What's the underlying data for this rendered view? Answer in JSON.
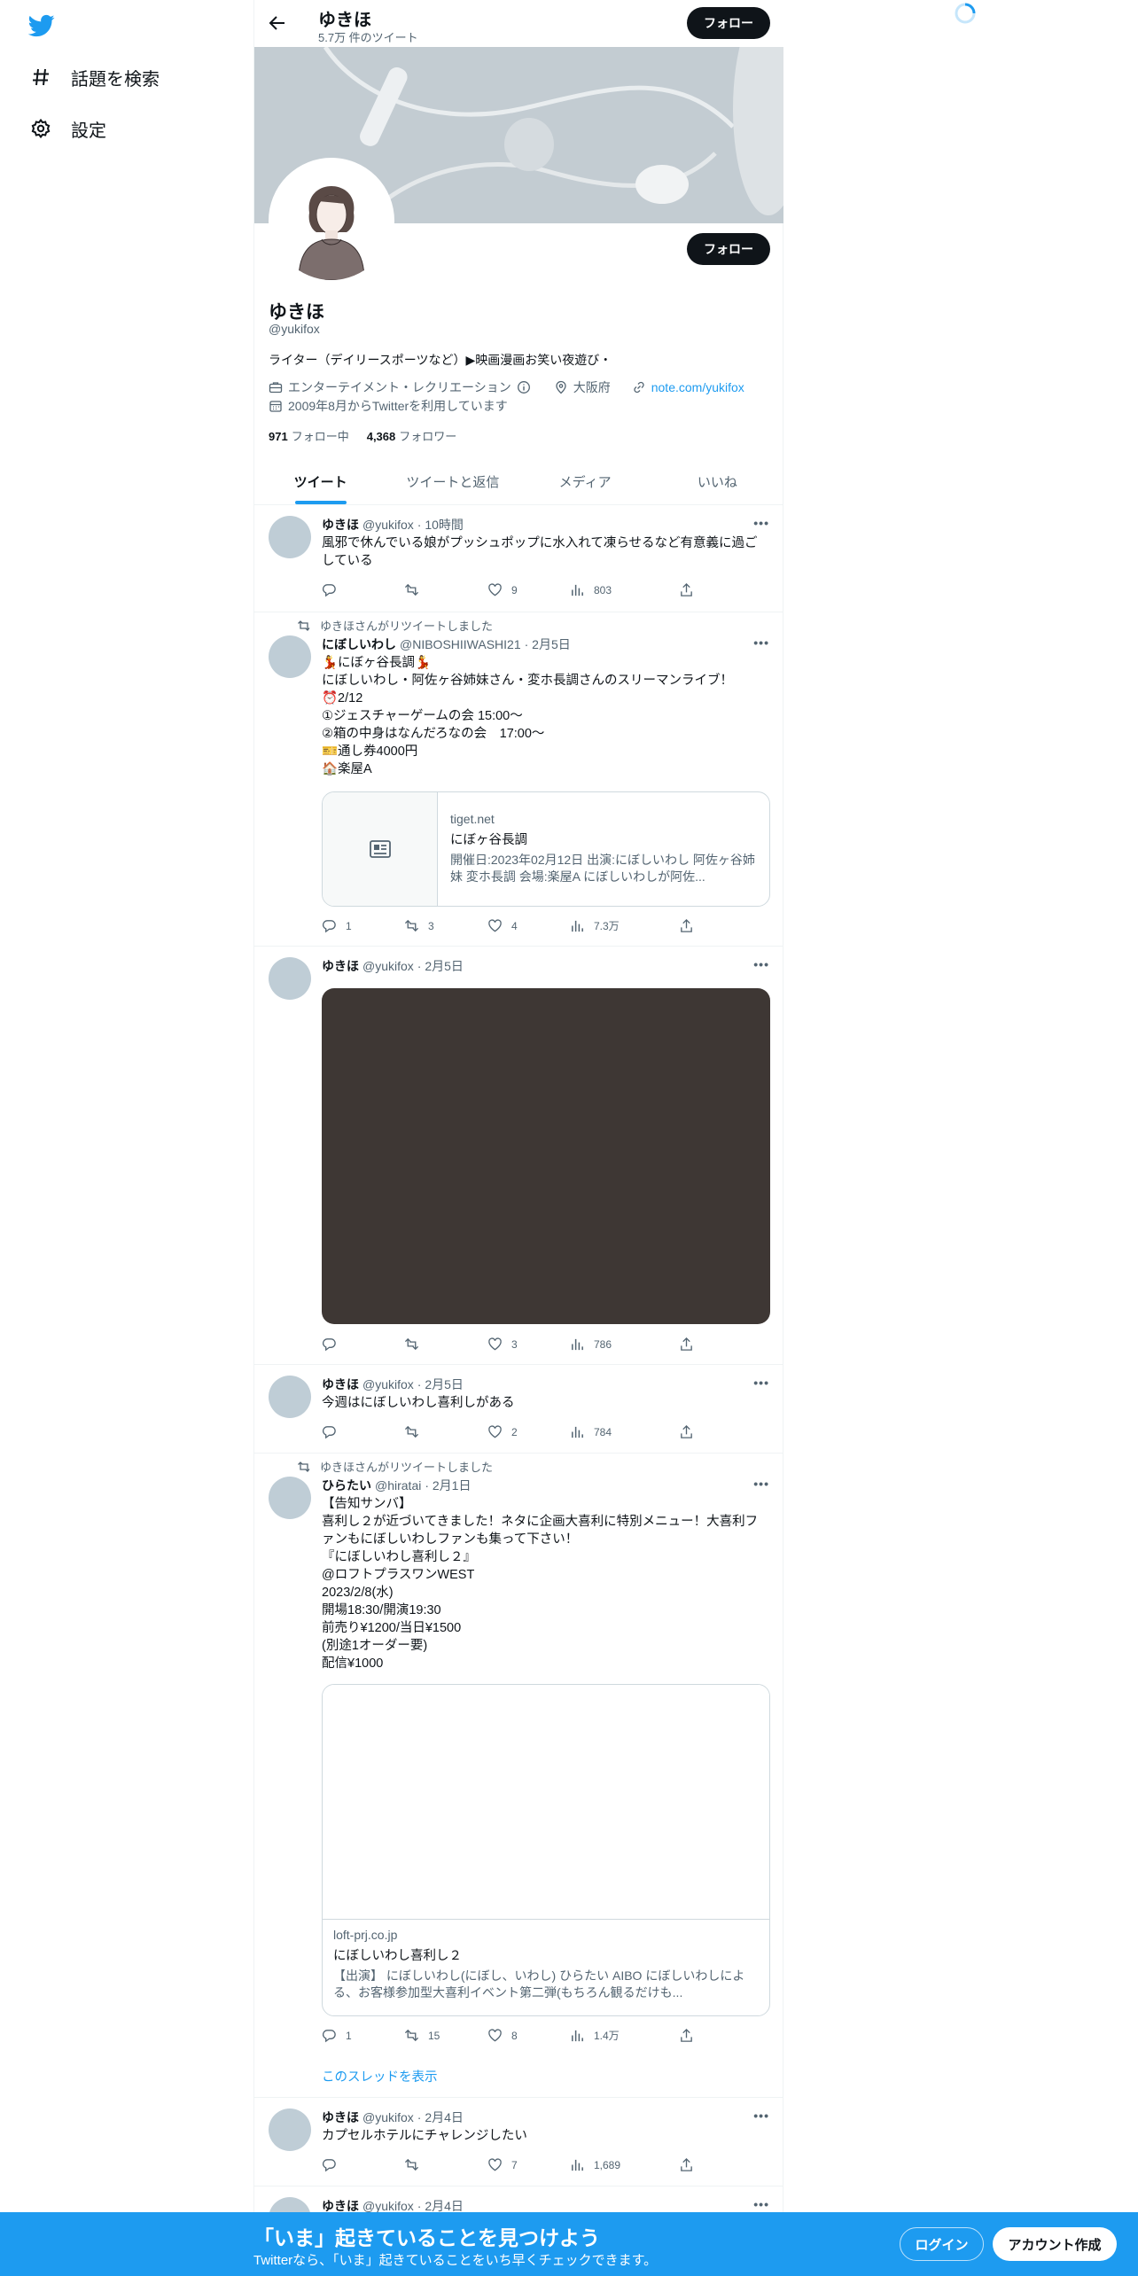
{
  "nav": {
    "explore": "話題を検索",
    "settings": "設定"
  },
  "header": {
    "name": "ゆきほ",
    "tweet_count": "5.7万 件のツイート",
    "follow": "フォロー"
  },
  "profile": {
    "name": "ゆきほ",
    "handle": "@yukifox",
    "bio": "ライター（デイリースポーツなど）▶映画漫画お笑い夜遊び・",
    "category": "エンターテイメント・レクリエーション",
    "location": "大阪府",
    "website": "note.com/yukifox",
    "joined": "2009年8月からTwitterを利用しています",
    "following_count": "971",
    "following_label": "フォロー中",
    "followers_count": "4,368",
    "followers_label": "フォロワー",
    "follow": "フォロー"
  },
  "tabs": [
    "ツイート",
    "ツイートと返信",
    "メディア",
    "いいね"
  ],
  "tweets": [
    {
      "name": "ゆきほ",
      "handle": "@yukifox",
      "time": "· 10時間",
      "text": "風邪で休んでいる娘がプッシュポップに水入れて凍らせるなど有意義に過ごしている",
      "replies": "",
      "retweets": "",
      "likes": "9",
      "views": "803"
    },
    {
      "retweeted_by": "ゆきほさんがリツイートしました",
      "name": "にぼしいわし",
      "handle": "@NIBOSHIIWASHI21",
      "time": "· 2月5日",
      "text": "💃にぼヶ谷長調💃\nにぼしいわし・阿佐ヶ谷姉妹さん・変ホ長調さんのスリーマンライブ！\n⏰2/12\n①ジェスチャーゲームの会 15:00〜\n②箱の中身はなんだろなの会　17:00〜\n🎫通し券4000円\n🏠楽屋A",
      "card": {
        "domain": "tiget.net",
        "title": "にぼヶ谷長調",
        "desc": "開催日:2023年02月12日 出演:にぼしいわし 阿佐ヶ谷姉妹 変ホ長調 会場:楽屋A にぼしいわしが阿佐..."
      },
      "replies": "1",
      "retweets": "3",
      "likes": "4",
      "views": "7.3万"
    },
    {
      "name": "ゆきほ",
      "handle": "@yukifox",
      "time": "· 2月5日",
      "text": "",
      "replies": "",
      "retweets": "",
      "likes": "3",
      "views": "786"
    },
    {
      "name": "ゆきほ",
      "handle": "@yukifox",
      "time": "· 2月5日",
      "text": "今週はにぼしいわし喜利しがある",
      "replies": "",
      "retweets": "",
      "likes": "2",
      "views": "784"
    },
    {
      "retweeted_by": "ゆきほさんがリツイートしました",
      "name": "ひらたい",
      "handle": "@hiratai",
      "time": "· 2月1日",
      "text": "【告知サンバ】\n喜利し２が近づいてきました！ネタに企画大喜利に特別メニュー！大喜利ファンもにぼしいわしファンも集って下さい！\n『にぼしいわし喜利し２』\n@ロフトプラスワンWEST\n2023/2/8(水)\n開場18:30/開演19:30\n前売り¥1200/当日¥1500\n(別途1オーダー要)\n配信¥1000",
      "card": {
        "domain": "loft-prj.co.jp",
        "title": "にぼしいわし喜利し２",
        "desc": "【出演】 にぼしいわし(にぼし、いわし) ひらたい AIBO にぼしいわしによる、お客様参加型大喜利イベント第二弾(もちろん観るだけも..."
      },
      "replies": "1",
      "retweets": "15",
      "likes": "8",
      "views": "1.4万",
      "thread": "このスレッドを表示"
    },
    {
      "name": "ゆきほ",
      "handle": "@yukifox",
      "time": "· 2月4日",
      "text": "カプセルホテルにチャレンジしたい",
      "replies": "",
      "retweets": "",
      "likes": "7",
      "views": "1,689"
    },
    {
      "name": "ゆきほ",
      "handle": "@yukifox",
      "time": "· 2月4日"
    }
  ],
  "bottom": {
    "title": "「いま」起きていることを見つけよう",
    "subtitle": "Twitterなら、「いま」起きていることをいち早くチェックできます。",
    "login": "ログイン",
    "signup": "アカウント作成"
  },
  "colors": {
    "accent": "#1d9bf0",
    "text": "#0f1419",
    "secondary": "#536471"
  }
}
